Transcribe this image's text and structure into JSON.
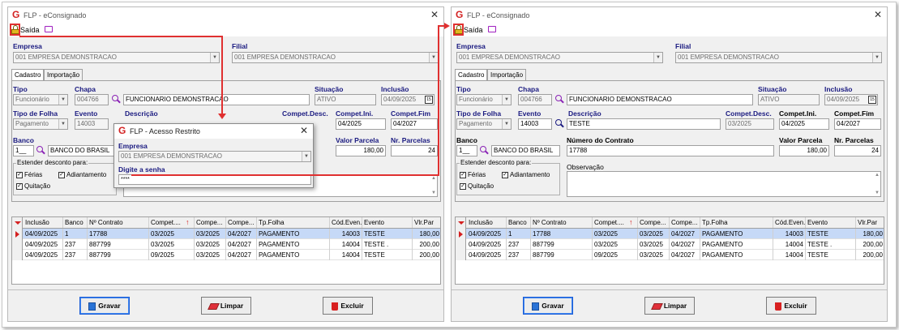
{
  "window_title": "FLP - eConsignado",
  "toolbar": {
    "saida_label": "Saída"
  },
  "labels": {
    "empresa": "Empresa",
    "filial": "Filial",
    "tipo": "Tipo",
    "chapa": "Chapa",
    "situacao": "Situação",
    "inclusao": "Inclusão",
    "tipo_folha": "Tipo de Folha",
    "evento": "Evento",
    "descricao": "Descrição",
    "compet_desc": "Compet.Desc.",
    "compet_ini": "Compet.Ini.",
    "compet_fim": "Compet.Fim",
    "banco": "Banco",
    "numero_contrato": "Número do Contrato",
    "valor_parcela": "Valor Parcela",
    "nr_parcelas": "Nr. Parcelas",
    "estender": "Estender desconto para:",
    "ferias": "Férias",
    "adiantamento": "Adiantamento",
    "quitacao": "Quitação",
    "observacao": "Observação"
  },
  "tabs": [
    "Cadastro",
    "Importação"
  ],
  "left": {
    "empresa": "001 EMPRESA DEMONSTRACAO",
    "filial": "001 EMPRESA DEMONSTRACAO",
    "tipo": "Funcionário",
    "chapa": "004766",
    "nome": "FUNCIONARIO DEMONSTRACAO",
    "situacao": "ATIVO",
    "inclusao": "04/09/2025",
    "tipo_folha": "Pagamento",
    "evento": "14003",
    "compet_ini": "04/2025",
    "compet_fim": "04/2027",
    "banco_codigo": "1__",
    "banco_nome": "BANCO DO BRASIL",
    "valor_parcela": "180,00",
    "nr_parcelas": "24"
  },
  "right": {
    "empresa": "001 EMPRESA DEMONSTRACAO",
    "filial": "001 EMPRESA DEMONSTRACAO",
    "tipo": "Funcionário",
    "chapa": "004766",
    "nome": "FUNCIONARIO DEMONSTRACAO",
    "situacao": "ATIVO",
    "inclusao": "04/09/2025",
    "tipo_folha": "Pagamento",
    "evento": "14003",
    "descricao": "TESTE",
    "compet_desc": "03/2025",
    "compet_ini": "04/2025",
    "compet_fim": "04/2027",
    "banco_codigo": "1__",
    "banco_nome": "BANCO DO BRASIL",
    "numero_contrato": "17788",
    "valor_parcela": "180,00",
    "nr_parcelas": "24"
  },
  "grid": {
    "headers": [
      "Inclusão",
      "Banco",
      "Nº Contrato",
      "Compet....",
      "Compe...",
      "Compe...",
      "Tp.Folha",
      "Cód.Even...",
      "Evento",
      "Vlr.Par"
    ],
    "headers_b": [
      "Inclusão",
      "Banco",
      "Nº Contrato",
      "Compet....",
      "Compe...",
      "Compe...",
      "Tp.Folha",
      "Cód.Even...",
      "Evento",
      "Vlr.Par"
    ],
    "rows": [
      [
        "04/09/2025",
        "1",
        "17788",
        "03/2025",
        "03/2025",
        "04/2027",
        "PAGAMENTO",
        "14003",
        "TESTE",
        "180,00"
      ],
      [
        "04/09/2025",
        "237",
        "887799",
        "03/2025",
        "03/2025",
        "04/2027",
        "PAGAMENTO",
        "14004",
        "TESTE .",
        "200,00"
      ],
      [
        "04/09/2025",
        "237",
        "887799",
        "09/2025",
        "03/2025",
        "04/2027",
        "PAGAMENTO",
        "14004",
        "TESTE",
        "200,00"
      ]
    ],
    "rows_b": [
      [
        "04/09/2025",
        "1",
        "17788",
        "03/2025",
        "03/2025",
        "04/2027",
        "PAGAMENTO",
        "14003",
        "TESTE",
        "180,00"
      ],
      [
        "04/09/2025",
        "237",
        "887799",
        "03/2025",
        "03/2025",
        "04/2027",
        "PAGAMENTO",
        "14004",
        "TESTE .",
        "200,00"
      ],
      [
        "04/09/2025",
        "237",
        "887799",
        "09/2025",
        "03/2025",
        "04/2027",
        "PAGAMENTO",
        "14004",
        "TESTE",
        "200,00"
      ]
    ]
  },
  "buttons": {
    "gravar": "Gravar",
    "limpar": "Limpar",
    "excluir": "Excluir"
  },
  "dialog": {
    "title": "FLP - Acesso Restrito",
    "empresa_label": "Empresa",
    "empresa_value": "001 EMPRESA DEMONSTRACAO",
    "senha_label": "Digite a senha",
    "senha_value": "****"
  },
  "colors": {
    "accent_red": "#e03030",
    "label_blue": "#1a1a80",
    "selected_row": "#c6d9f7"
  }
}
